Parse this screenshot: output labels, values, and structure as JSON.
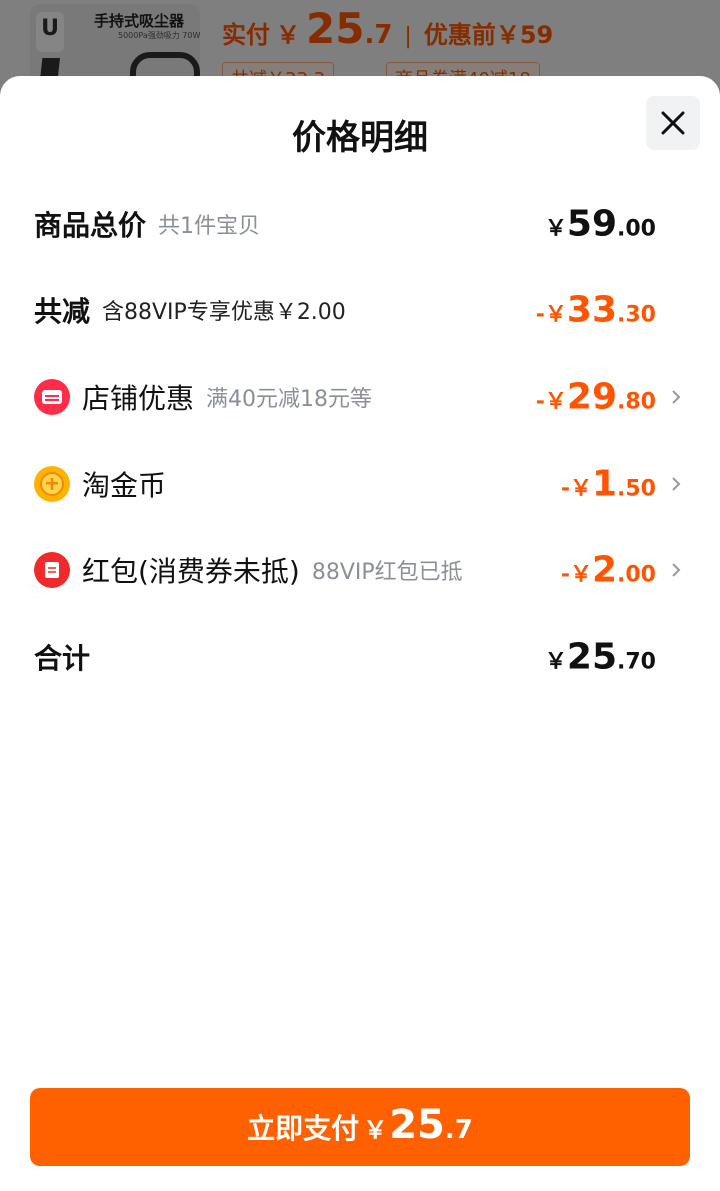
{
  "background": {
    "product_title": "手持式吸尘器",
    "product_subtitle": "5000Pa强劲吸力 70W功率",
    "price_label": "实付",
    "price_yen": "￥",
    "price_int": "25",
    "price_dec": ".7",
    "separator": "|",
    "original_price": "优惠前￥59",
    "tag1": "共减￥33.3",
    "tag2": "商品券满40减18"
  },
  "sheet": {
    "title": "价格明细",
    "close_icon": "close-icon"
  },
  "rows": {
    "total": {
      "label": "商品总价",
      "sub": "共1件宝贝",
      "yen": "￥",
      "int": "59",
      "dec": ".00"
    },
    "reduce": {
      "label": "共减",
      "sub": "含88VIP专享优惠￥2.00",
      "yen": "-￥",
      "int": "33",
      "dec": ".30"
    },
    "shop": {
      "label": "店铺优惠",
      "sub": "满40元减18元等",
      "yen": "-￥",
      "int": "29",
      "dec": ".80",
      "icon": "shop-coupon-icon"
    },
    "coin": {
      "label": "淘金币",
      "sub": "",
      "yen": "-￥",
      "int": "1",
      "dec": ".50",
      "icon": "coin-icon"
    },
    "redpack": {
      "label": "红包(消费券未抵)",
      "sub": "88VIP红包已抵",
      "yen": "-￥",
      "int": "2",
      "dec": ".00",
      "icon": "red-packet-icon"
    },
    "sum": {
      "label": "合计",
      "yen": "￥",
      "int": "25",
      "dec": ".70"
    }
  },
  "pay_button": {
    "label": "立即支付",
    "yen": "￥",
    "int": "25",
    "dec": ".7"
  },
  "colors": {
    "accent": "#ff6000",
    "discount": "#ff5500",
    "text": "#111111",
    "muted": "#8a8f99"
  }
}
